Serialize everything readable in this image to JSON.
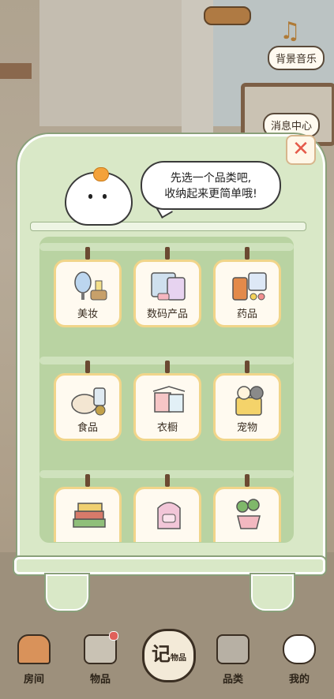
{
  "top_buttons": {
    "music": "背景音乐",
    "messages": "消息中心"
  },
  "bubble": {
    "line1": "先选一个品类吧,",
    "line2": "收纳起来更简单哦!"
  },
  "close_symbol": "✕",
  "categories": [
    {
      "label": "美妆",
      "icon": "cosmetics-icon"
    },
    {
      "label": "数码产品",
      "icon": "digital-products-icon"
    },
    {
      "label": "药品",
      "icon": "medicine-icon"
    },
    {
      "label": "食品",
      "icon": "food-icon"
    },
    {
      "label": "衣橱",
      "icon": "wardrobe-icon"
    },
    {
      "label": "宠物",
      "icon": "pet-icon"
    },
    {
      "label": "",
      "icon": "books-icon"
    },
    {
      "label": "",
      "icon": "backpack-icon"
    },
    {
      "label": "",
      "icon": "plant-icon"
    }
  ],
  "nav": {
    "room": "房间",
    "items": "物品",
    "record": "记",
    "record_sub": "物品",
    "category": "品类",
    "mine": "我的"
  },
  "colors": {
    "card_border": "#f1d58a",
    "cabinet": "#d9e8c7",
    "close": "#e55a4a",
    "badge": "#e0605a"
  }
}
